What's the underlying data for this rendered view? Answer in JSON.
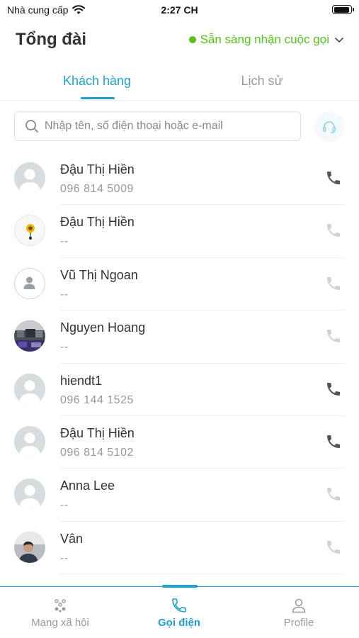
{
  "status_bar": {
    "carrier": "Nhà cung cấp",
    "time": "2:27 CH"
  },
  "header": {
    "title": "Tổng đài",
    "availability": "Sẵn sàng nhận cuộc gọi"
  },
  "tabs": [
    {
      "label": "Khách hàng",
      "active": true
    },
    {
      "label": "Lịch sử",
      "active": false
    }
  ],
  "search": {
    "placeholder": "Nhập tên, số điện thoại hoặc e-mail"
  },
  "contacts": [
    {
      "name": "Đậu Thị Hiền",
      "phone": "096 814 5009",
      "avatar": "default",
      "callable": true
    },
    {
      "name": "Đậu Thị Hiền",
      "phone": "--",
      "avatar": "sunflower",
      "callable": false
    },
    {
      "name": "Vũ Thị Ngoan",
      "phone": "--",
      "avatar": "outline",
      "callable": false
    },
    {
      "name": "Nguyen Hoang",
      "phone": "--",
      "avatar": "photo-room",
      "callable": false
    },
    {
      "name": "hiendt1",
      "phone": "096 144 1525",
      "avatar": "default",
      "callable": true
    },
    {
      "name": "Đậu Thị Hiền",
      "phone": "096 814 5102",
      "avatar": "default",
      "callable": true
    },
    {
      "name": "Anna Lee",
      "phone": "--",
      "avatar": "default",
      "callable": false
    },
    {
      "name": "Vân",
      "phone": "--",
      "avatar": "photo-person",
      "callable": false
    }
  ],
  "bottom_nav": [
    {
      "label": "Mạng xã hội",
      "icon": "social-icon",
      "active": false
    },
    {
      "label": "Gọi điện",
      "icon": "phone-icon",
      "active": true
    },
    {
      "label": "Profile",
      "icon": "person-icon",
      "active": false
    }
  ],
  "colors": {
    "accent": "#1e9fd6",
    "available": "#52c41a",
    "text": "#333333",
    "muted": "#999999"
  }
}
